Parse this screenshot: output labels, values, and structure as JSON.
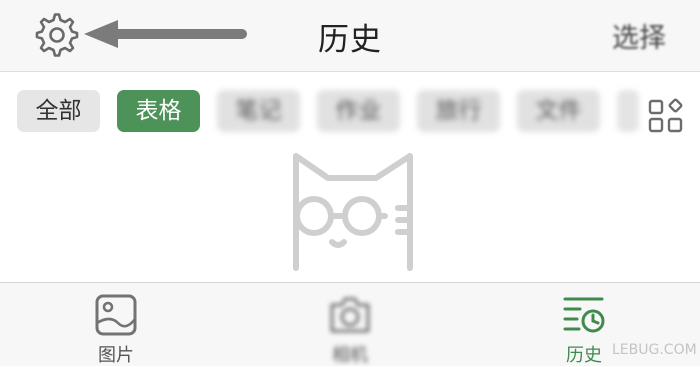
{
  "header": {
    "title": "历史",
    "select_label": "选择",
    "settings_icon": "gear-icon",
    "annotation_icon": "arrow-left-icon"
  },
  "filters": {
    "chips": [
      {
        "label": "全部",
        "state": "default"
      },
      {
        "label": "表格",
        "state": "selected"
      },
      {
        "label": "笔记",
        "state": "blurred"
      },
      {
        "label": "作业",
        "state": "blurred"
      },
      {
        "label": "旅行",
        "state": "blurred"
      },
      {
        "label": "文件",
        "state": "blurred"
      }
    ],
    "layout_icon": "grid-icon"
  },
  "empty_state": {
    "icon": "cat-with-glasses-icon"
  },
  "tabbar": {
    "tabs": [
      {
        "label": "图片",
        "icon": "image-icon"
      },
      {
        "label": "相机",
        "icon": "camera-icon"
      },
      {
        "label": "历史",
        "icon": "history-icon",
        "active": true
      }
    ]
  },
  "watermark": "LEBUG.COM",
  "colors": {
    "accent": "#4d9258",
    "header_bg": "#f7f7f7",
    "chip_bg": "#e6e6e6",
    "icon_gray": "#7a7a7a"
  }
}
